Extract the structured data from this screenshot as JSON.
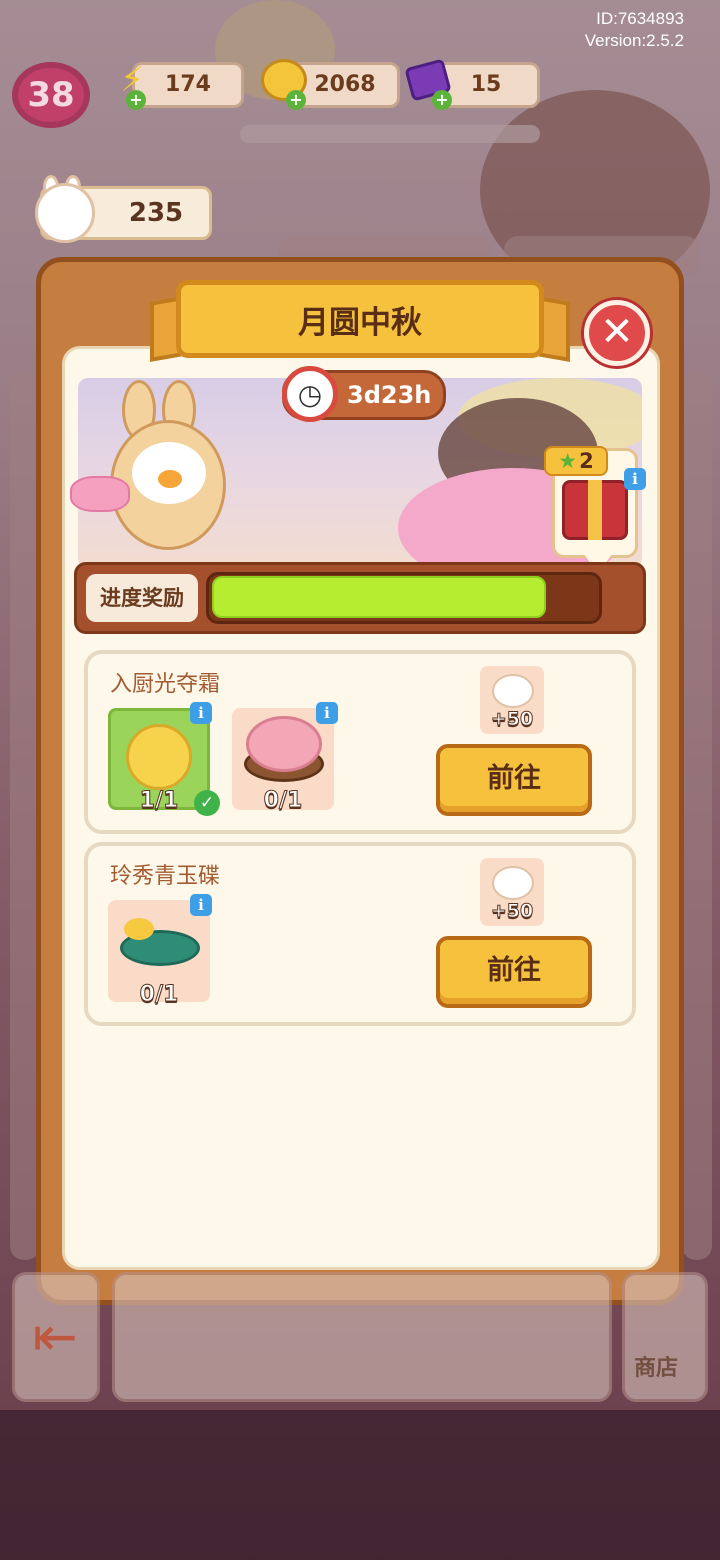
{
  "meta": {
    "id": "ID:7634893",
    "version": "Version:2.5.2"
  },
  "header": {
    "level": "38",
    "resources": [
      {
        "name": "energy",
        "value": "174",
        "icon": "lightning-icon"
      },
      {
        "name": "coins",
        "value": "2068",
        "icon": "coin-icon"
      },
      {
        "name": "gems",
        "value": "15",
        "icon": "gem-icon"
      }
    ],
    "bunny_points": "235"
  },
  "event": {
    "title": "月圆中秋",
    "timer": "3d23h",
    "gift_stars": "2",
    "progress_label": "进度奖励",
    "progress": 0.87
  },
  "tasks": [
    {
      "title": "入厨光夺霜",
      "items": [
        {
          "name": "golden-mooncake-icon",
          "count": "1/1",
          "done": true
        },
        {
          "name": "flower-mooncake-plate-icon",
          "count": "0/1",
          "done": false
        }
      ],
      "reward": "+50",
      "button": "前往"
    },
    {
      "title": "玲秀青玉碟",
      "items": [
        {
          "name": "jade-plate-icon",
          "count": "0/1",
          "done": false
        }
      ],
      "reward": "+50",
      "button": "前往"
    }
  ],
  "footer": {
    "shop_label": "商店"
  },
  "colors": {
    "accent": "#f6c23d",
    "progress": "#b5ee31",
    "panel": "#c67d40",
    "close": "#e04a4a"
  }
}
